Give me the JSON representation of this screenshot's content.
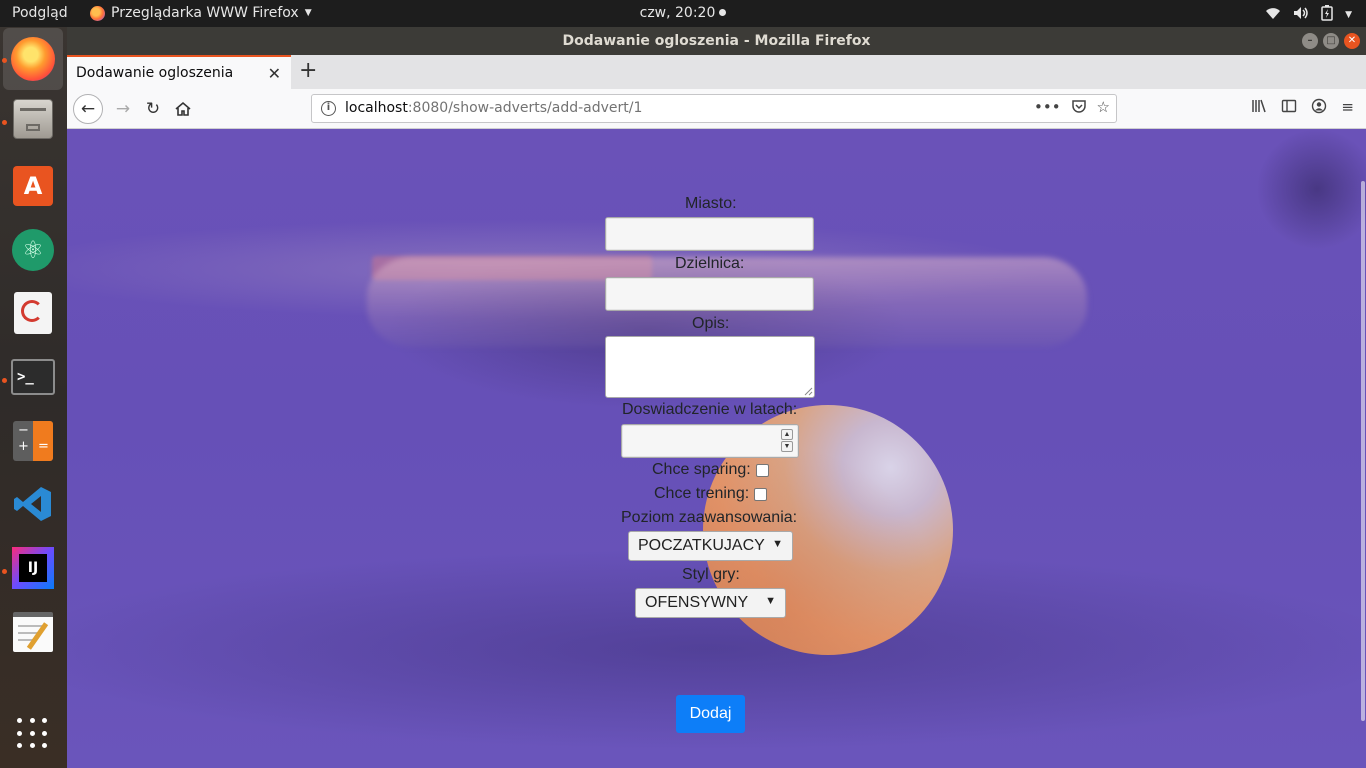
{
  "top_panel": {
    "activities": "Podgląd",
    "app_name": "Przeglądarka WWW Firefox",
    "clock": "czw, 20:20"
  },
  "window": {
    "title": "Dodawanie ogloszenia - Mozilla Firefox"
  },
  "tab": {
    "title": "Dodawanie ogloszenia"
  },
  "url": {
    "host": "localhost",
    "rest": ":8080/show-adverts/add-advert/1"
  },
  "form": {
    "city_label": "Miasto:",
    "district_label": "Dzielnica:",
    "description_label": "Opis:",
    "experience_label": "Doswiadczenie w latach:",
    "sparring_label": "Chce sparing:",
    "training_label": "Chce trening:",
    "level_label": "Poziom zaawansowania:",
    "level_value": "POCZATKUJACY",
    "style_label": "Styl gry:",
    "style_value": "OFENSYWNY",
    "submit_label": "Dodaj"
  },
  "dock": {
    "items": [
      "firefox-icon",
      "files-icon",
      "software-center-icon",
      "atom-icon",
      "document-viewer-icon",
      "terminal-icon",
      "calculator-icon",
      "vscode-icon",
      "intellij-icon",
      "text-editor-icon",
      "show-apps-icon"
    ]
  },
  "colors": {
    "accent": "#e95420",
    "button": "#0d7ef8",
    "background": "#6650b7"
  }
}
